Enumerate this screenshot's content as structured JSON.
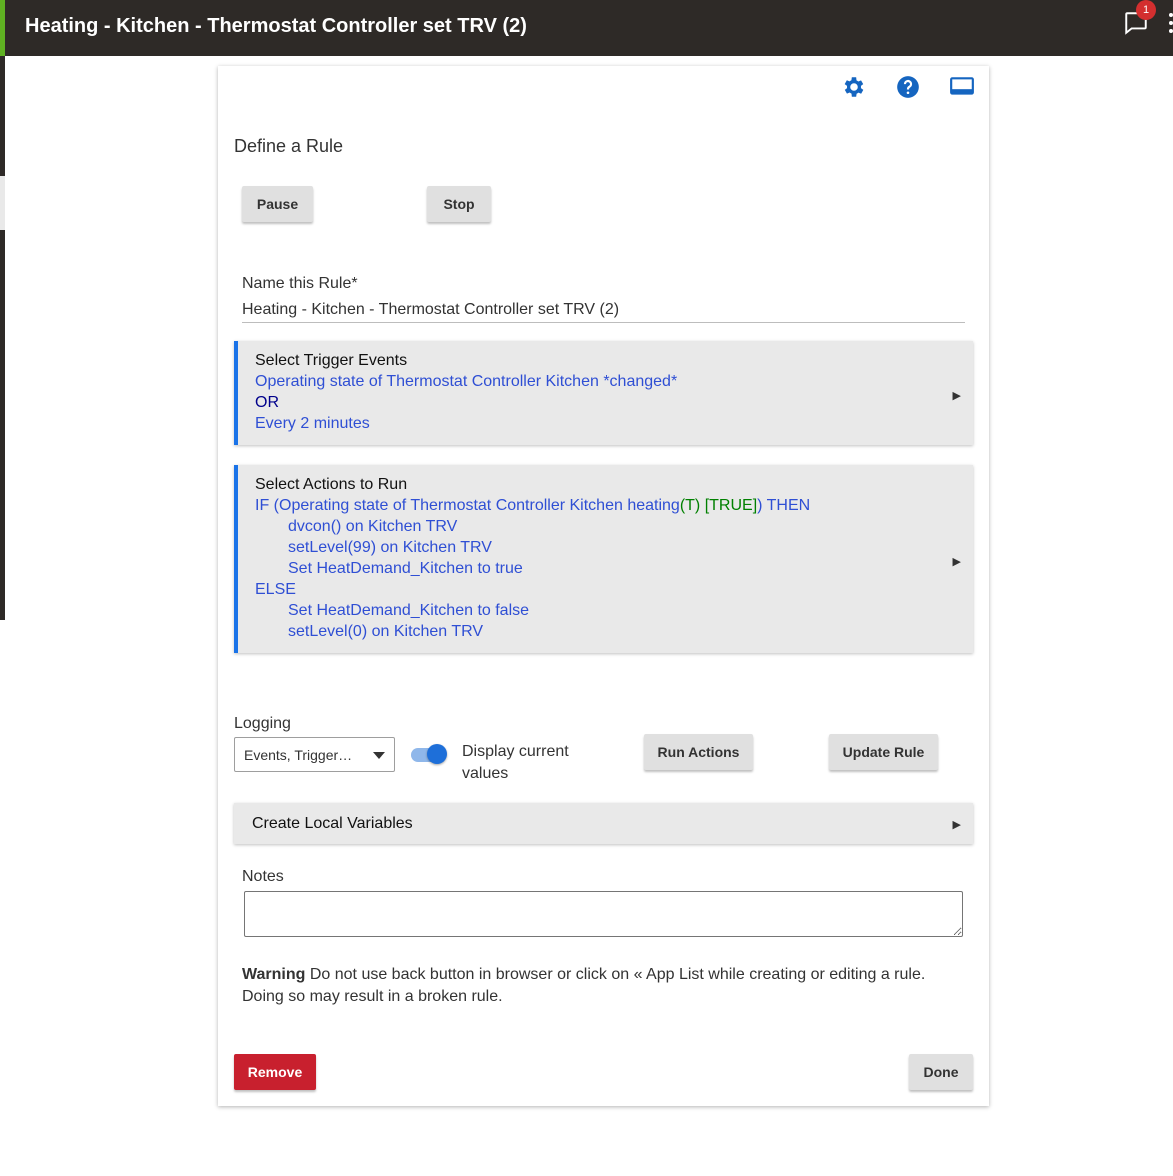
{
  "header": {
    "title": "Heating - Kitchen - Thermostat Controller set TRV (2)",
    "notification_count": "1",
    "icons": [
      "chat-icon",
      "more-vert-icon"
    ],
    "accent_color": "#5fb122",
    "background_color": "#2e2a27"
  },
  "card": {
    "toolbar_icons": [
      "settings-gear-icon",
      "help-icon",
      "laptop-icon"
    ],
    "icon_color": "#1565c0",
    "heading": "Define a Rule",
    "pause_label": "Pause",
    "stop_label": "Stop",
    "name_label": "Name this Rule*",
    "name_value": "Heating - Kitchen - Thermostat Controller set TRV (2)",
    "triggers": {
      "title": "Select Trigger Events",
      "line1": "Operating state of Thermostat Controller Kitchen *changed*",
      "line2": "OR",
      "line3": "Every 2 minutes"
    },
    "actions": {
      "title": "Select Actions to Run",
      "if_prefix": "IF (Operating state of Thermostat Controller Kitchen heating",
      "if_state": "(T) [TRUE]",
      "if_suffix": ") THEN",
      "then_lines": [
        "dvcon() on Kitchen TRV",
        "setLevel(99) on Kitchen TRV",
        "Set HeatDemand_Kitchen to true"
      ],
      "else_label": "ELSE",
      "else_lines": [
        "Set HeatDemand_Kitchen to false",
        "setLevel(0) on Kitchen TRV"
      ]
    },
    "logging_label": "Logging",
    "logging_value": "Events, Trigger…",
    "toggle_label": "Display current values",
    "toggle_on": true,
    "run_actions_label": "Run Actions",
    "update_rule_label": "Update Rule",
    "local_variables_label": "Create Local Variables",
    "notes_label": "Notes",
    "notes_value": "",
    "warning_bold": "Warning",
    "warning_text": " Do not use back button in browser or click on « App List while creating or editing a rule. Doing so may result in a broken rule.",
    "remove_label": "Remove",
    "done_label": "Done"
  }
}
